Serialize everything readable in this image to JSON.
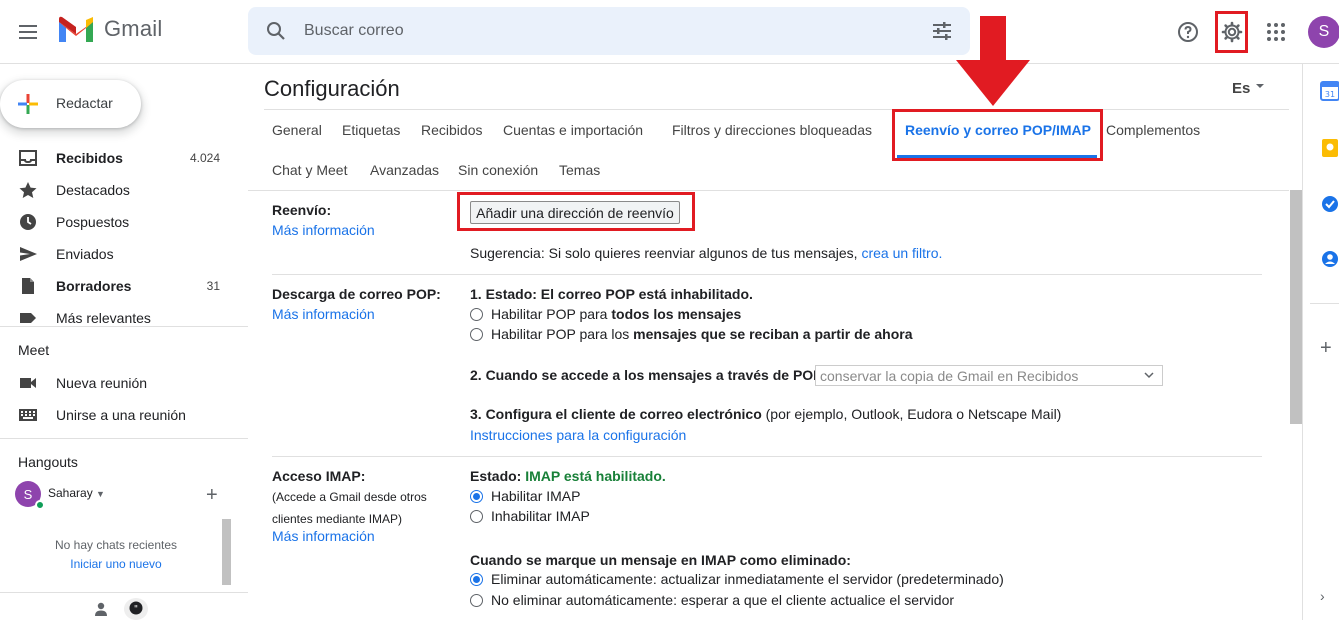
{
  "header": {
    "app_name": "Gmail",
    "search_placeholder": "Buscar correo",
    "avatar_letter": "S"
  },
  "sidebar": {
    "compose_label": "Redactar",
    "items": [
      {
        "label": "Recibidos",
        "count": "4.024",
        "icon": "inbox-icon",
        "bold": true
      },
      {
        "label": "Destacados",
        "count": "",
        "icon": "star-icon",
        "bold": false
      },
      {
        "label": "Pospuestos",
        "count": "",
        "icon": "clock-icon",
        "bold": false
      },
      {
        "label": "Enviados",
        "count": "",
        "icon": "send-icon",
        "bold": false
      },
      {
        "label": "Borradores",
        "count": "31",
        "icon": "draft-icon",
        "bold": true
      },
      {
        "label": "Más relevantes",
        "count": "",
        "icon": "label-icon",
        "bold": false
      }
    ],
    "meet": {
      "title": "Meet",
      "items": [
        {
          "label": "Nueva reunión",
          "icon": "video-icon"
        },
        {
          "label": "Unirse a una reunión",
          "icon": "keyboard-icon"
        }
      ]
    },
    "hangouts": {
      "title": "Hangouts",
      "user_name": "Saharay",
      "user_letter": "S",
      "no_chats": "No hay chats recientes",
      "start_new": "Iniciar uno nuevo"
    }
  },
  "settings": {
    "title": "Configuración",
    "language": "Es",
    "tabs": [
      {
        "label": "General",
        "active": false
      },
      {
        "label": "Etiquetas",
        "active": false
      },
      {
        "label": "Recibidos",
        "active": false
      },
      {
        "label": "Cuentas e importación",
        "active": false
      },
      {
        "label": "Filtros y direcciones bloqueadas",
        "active": false
      },
      {
        "label": "Reenvío y correo POP/IMAP",
        "active": true
      },
      {
        "label": "Complementos",
        "active": false
      },
      {
        "label": "Chat y Meet",
        "active": false
      },
      {
        "label": "Avanzadas",
        "active": false
      },
      {
        "label": "Sin conexión",
        "active": false
      },
      {
        "label": "Temas",
        "active": false
      }
    ],
    "more_info": "Más información",
    "forwarding": {
      "label": "Reenvío:",
      "button": "Añadir una dirección de reenvío",
      "tip_prefix": "Sugerencia: Si solo quieres reenviar algunos de tus mensajes, ",
      "tip_link": "crea un filtro."
    },
    "pop": {
      "label": "Descarga de correo POP:",
      "status": "1. Estado: El correo POP está inhabilitado.",
      "option_all_prefix": "Habilitar POP para ",
      "option_all_bold": "todos los mensajes",
      "option_new_prefix": "Habilitar POP para los ",
      "option_new_bold": "mensajes que se reciban a partir de ahora",
      "access_label": "2. Cuando se accede a los mensajes a través de POP",
      "access_select": "conservar la copia de Gmail en Recibidos",
      "client_label": "3. Configura el cliente de correo electrónico",
      "client_examples": " (por ejemplo, Outlook, Eudora o Netscape Mail)",
      "client_link": "Instrucciones para la configuración"
    },
    "imap": {
      "label": "Acceso IMAP:",
      "sublabel": "(Accede a Gmail desde otros clientes mediante IMAP)",
      "status_label": "Estado: ",
      "status_value": "IMAP está habilitado.",
      "enable": "Habilitar IMAP",
      "disable": "Inhabilitar IMAP",
      "deleted_title": "Cuando se marque un mensaje en IMAP como eliminado:",
      "auto_delete": "Eliminar automáticamente: actualizar inmediatamente el servidor (predeterminado)",
      "no_auto_delete": "No eliminar automáticamente: esperar a que el cliente actualice el servidor"
    }
  },
  "colors": {
    "accent": "#1a73e8",
    "highlight": "#e11b22",
    "status_green": "#188038"
  }
}
